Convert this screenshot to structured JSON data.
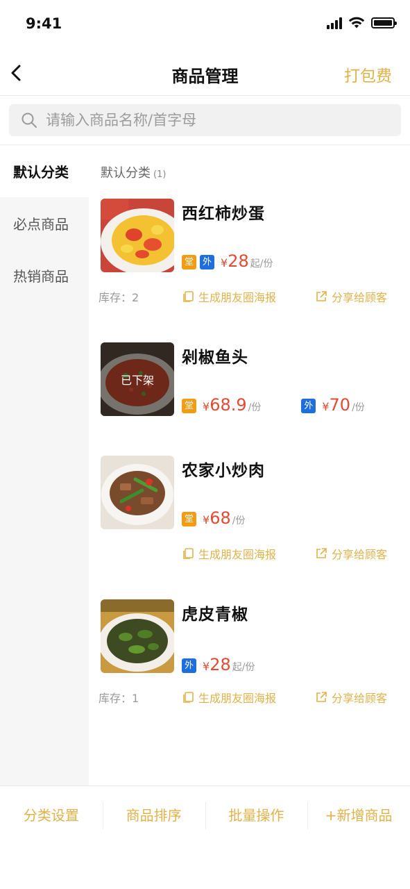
{
  "status_bar": {
    "time": "9:41"
  },
  "nav": {
    "title": "商品管理",
    "action": "打包费"
  },
  "search": {
    "placeholder": "请输入商品名称/首字母"
  },
  "sidebar": {
    "items": [
      {
        "label": "默认分类",
        "active": true
      },
      {
        "label": "必点商品",
        "active": false
      },
      {
        "label": "热销商品",
        "active": false
      }
    ]
  },
  "category": {
    "title": "默认分类",
    "count": "(1)"
  },
  "tags": {
    "dine": "堂",
    "takeout": "外"
  },
  "currency": "¥",
  "actions": {
    "poster": "生成朋友圈海报",
    "share": "分享给顾客"
  },
  "products": [
    {
      "name": "西红柿炒蛋",
      "prices": [
        {
          "tags": [
            "堂",
            "外"
          ],
          "price": "28",
          "unit": "起/份"
        }
      ],
      "stock": "库存：2",
      "off_shelf": ""
    },
    {
      "name": "剁椒鱼头",
      "prices": [
        {
          "tags": [
            "堂"
          ],
          "price": "68.9",
          "unit": "/份"
        },
        {
          "tags": [
            "外"
          ],
          "price": "70",
          "unit": "/份"
        }
      ],
      "stock": "",
      "off_shelf": "已下架"
    },
    {
      "name": "农家小炒肉",
      "prices": [
        {
          "tags": [
            "堂"
          ],
          "price": "68",
          "unit": "/份"
        }
      ],
      "stock": "",
      "off_shelf": ""
    },
    {
      "name": "虎皮青椒",
      "prices": [
        {
          "tags": [
            "外"
          ],
          "price": "28",
          "unit": "起/份"
        }
      ],
      "stock": "库存：1",
      "off_shelf": ""
    }
  ],
  "bottom_bar": {
    "category_settings": "分类设置",
    "sort_products": "商品排序",
    "batch_ops": "批量操作",
    "add_product": "+新增商品"
  },
  "colors": {
    "accent": "#e0b24b",
    "price": "#e44a31",
    "dine_tag": "#f39c12",
    "takeout_tag": "#1e6ee0"
  }
}
